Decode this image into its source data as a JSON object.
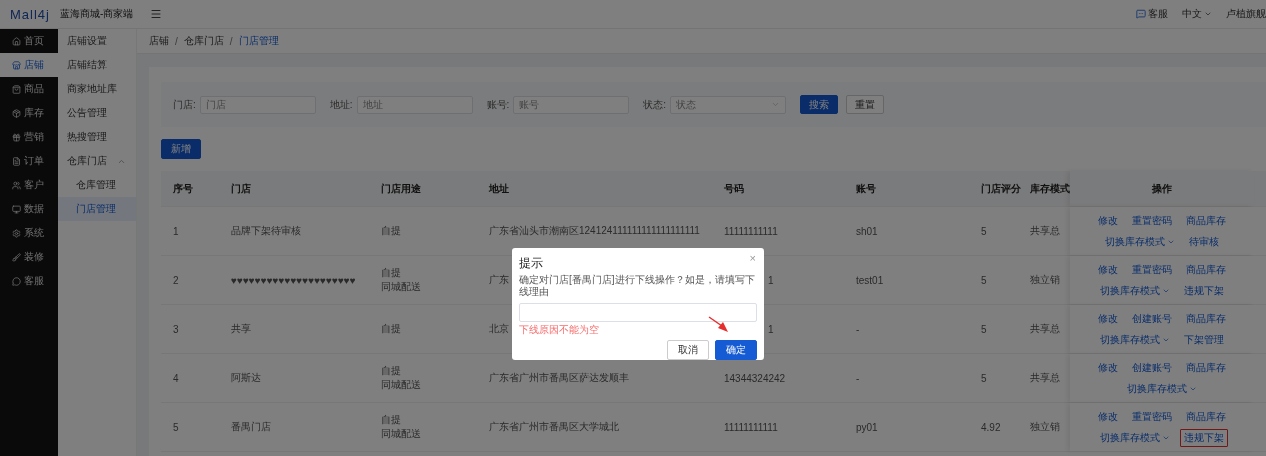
{
  "header": {
    "logo": "Mall4j",
    "title": "蓝海商城-商家端",
    "links": [
      {
        "label": "客服",
        "kind": "service"
      },
      {
        "label": "中文",
        "kind": "dropdown"
      },
      {
        "label": "卢植旗舰",
        "kind": "plain"
      }
    ]
  },
  "main_nav": [
    {
      "label": "首页",
      "selected": false
    },
    {
      "label": "店铺",
      "selected": true
    },
    {
      "label": "商品",
      "selected": false
    },
    {
      "label": "库存",
      "selected": false
    },
    {
      "label": "营销",
      "selected": false
    },
    {
      "label": "订单",
      "selected": false
    },
    {
      "label": "客户",
      "selected": false
    },
    {
      "label": "数据",
      "selected": false
    },
    {
      "label": "系统",
      "selected": false
    },
    {
      "label": "装修",
      "selected": false
    },
    {
      "label": "客服",
      "selected": false
    }
  ],
  "sub_nav": [
    {
      "label": "店铺设置",
      "selected": false
    },
    {
      "label": "店铺结算",
      "selected": false
    },
    {
      "label": "商家地址库",
      "selected": false
    },
    {
      "label": "公告管理",
      "selected": false
    },
    {
      "label": "热搜管理",
      "selected": false
    },
    {
      "label": "仓库门店",
      "selected": false,
      "expanded": true,
      "children": [
        {
          "label": "仓库管理",
          "selected": false
        },
        {
          "label": "门店管理",
          "selected": true
        }
      ]
    }
  ],
  "breadcrumb": {
    "separator": "/",
    "items": [
      {
        "label": "店铺",
        "current": false
      },
      {
        "label": "仓库门店",
        "current": false
      },
      {
        "label": "门店管理",
        "current": true
      }
    ]
  },
  "filters": [
    {
      "label": "门店:",
      "placeholder": "门店",
      "kind": "input"
    },
    {
      "label": "地址:",
      "placeholder": "地址",
      "kind": "input"
    },
    {
      "label": "账号:",
      "placeholder": "账号",
      "kind": "input"
    },
    {
      "label": "状态:",
      "placeholder": "状态",
      "kind": "select"
    }
  ],
  "filter_buttons": [
    {
      "label": "搜索",
      "kind": "primary"
    },
    {
      "label": "重置",
      "kind": "default"
    }
  ],
  "add_button": "新增",
  "table": {
    "columns": [
      "序号",
      "门店",
      "门店用途",
      "地址",
      "号码",
      "账号",
      "门店评分",
      "库存模式"
    ],
    "action_column": "操作",
    "rows": [
      {
        "cells": [
          "1",
          "品牌下架待审核",
          [
            "自提"
          ],
          "广东省汕头市潮南区124124111111111111111111",
          "11111111111",
          "sh01",
          "5",
          "共享总"
        ],
        "actions": [
          [
            {
              "label": "修改",
              "kind": "link",
              "highlighted": false
            },
            {
              "label": "重置密码",
              "kind": "link",
              "highlighted": false
            },
            {
              "label": "商品库存",
              "kind": "link",
              "highlighted": false
            }
          ],
          [
            {
              "label": "切换库存模式",
              "kind": "dropdown",
              "highlighted": false
            },
            {
              "label": "待审核",
              "kind": "link",
              "highlighted": false
            }
          ]
        ]
      },
      {
        "cells": [
          "2",
          "♥♥♥♥♥♥♥♥♥♥♥♥♥♥♥♥♥♥♥♥♥",
          [
            "自提",
            "同城配送"
          ],
          "广东",
          {
            "text": "1"
          },
          "test01",
          "5",
          "独立销"
        ],
        "actions": [
          [
            {
              "label": "修改",
              "kind": "link",
              "highlighted": false
            },
            {
              "label": "重置密码",
              "kind": "link",
              "highlighted": false
            },
            {
              "label": "商品库存",
              "kind": "link",
              "highlighted": false
            }
          ],
          [
            {
              "label": "切换库存模式",
              "kind": "dropdown",
              "highlighted": false
            },
            {
              "label": "违规下架",
              "kind": "link",
              "highlighted": false
            }
          ]
        ]
      },
      {
        "cells": [
          "3",
          "共享",
          [
            "自提"
          ],
          "北京",
          {
            "text": "1"
          },
          "-",
          "5",
          "共享总"
        ],
        "actions": [
          [
            {
              "label": "修改",
              "kind": "link",
              "highlighted": false
            },
            {
              "label": "创建账号",
              "kind": "link",
              "highlighted": false
            },
            {
              "label": "商品库存",
              "kind": "link",
              "highlighted": false
            }
          ],
          [
            {
              "label": "切换库存模式",
              "kind": "dropdown",
              "highlighted": false
            },
            {
              "label": "下架管理",
              "kind": "link",
              "highlighted": false
            }
          ]
        ]
      },
      {
        "cells": [
          "4",
          "阿斯达",
          [
            "自提",
            "同城配送"
          ],
          "广东省广州市番禺区萨达发顺丰",
          "14344324242",
          "-",
          "5",
          "共享总"
        ],
        "actions": [
          [
            {
              "label": "修改",
              "kind": "link",
              "highlighted": false
            },
            {
              "label": "创建账号",
              "kind": "link",
              "highlighted": false
            },
            {
              "label": "商品库存",
              "kind": "link",
              "highlighted": false
            }
          ],
          [
            {
              "label": "切换库存模式",
              "kind": "dropdown",
              "highlighted": false
            }
          ]
        ]
      },
      {
        "cells": [
          "5",
          "番禺门店",
          [
            "自提",
            "同城配送"
          ],
          "广东省广州市番禺区大学城北",
          "11111111111",
          "py01",
          "4.92",
          "独立销"
        ],
        "actions": [
          [
            {
              "label": "修改",
              "kind": "link",
              "highlighted": false
            },
            {
              "label": "重置密码",
              "kind": "link",
              "highlighted": false
            },
            {
              "label": "商品库存",
              "kind": "link",
              "highlighted": false
            }
          ],
          [
            {
              "label": "切换库存模式",
              "kind": "dropdown",
              "highlighted": false
            },
            {
              "label": "违规下架",
              "kind": "link",
              "highlighted": true
            }
          ]
        ]
      }
    ]
  },
  "dialog": {
    "title": "提示",
    "close": "×",
    "message": "确定对门店[番禺门店]进行下线操作？如是，请填写下线理由",
    "error": "下线原因不能为空",
    "buttons": [
      {
        "label": "取消",
        "kind": "default"
      },
      {
        "label": "确定",
        "kind": "primary"
      }
    ],
    "arrow_annotation": true
  }
}
